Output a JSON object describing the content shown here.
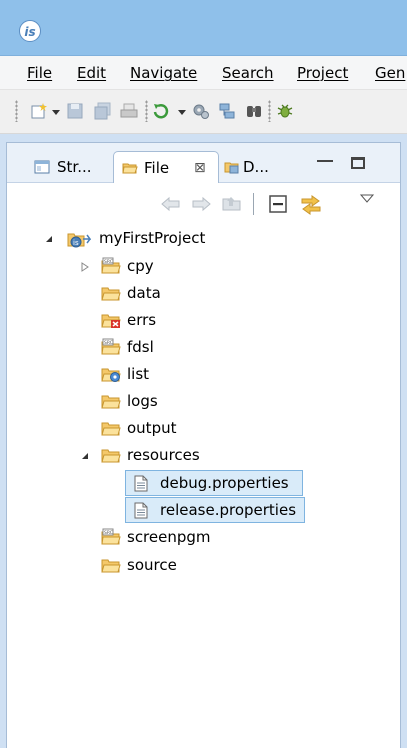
{
  "titlebar": {
    "logo_text": "is"
  },
  "menu": {
    "items": [
      "File",
      "Edit",
      "Navigate",
      "Search",
      "Project",
      "Gen"
    ]
  },
  "toolbar": {
    "icons": [
      "new-wizard-icon",
      "save-icon",
      "save-all-icon",
      "print-icon",
      "refresh-icon",
      "build-icon",
      "deploy-icon",
      "search-binoculars-icon",
      "debug-icon"
    ]
  },
  "panel": {
    "tabs": [
      {
        "label": "Str...",
        "icon": "structure-icon",
        "active": false
      },
      {
        "label": "File",
        "icon": "folder-icon",
        "active": true,
        "close": "⊠"
      },
      {
        "label": "D...",
        "icon": "data-icon",
        "active": false
      }
    ],
    "minimize": "▭",
    "maximize": "☐"
  },
  "tree": {
    "project": "myFirstProject",
    "items": [
      {
        "label": "cpy",
        "icon": "source-folder-icon",
        "expandable": true,
        "expanded": false
      },
      {
        "label": "data",
        "icon": "folder-icon"
      },
      {
        "label": "errs",
        "icon": "error-folder-icon"
      },
      {
        "label": "fdsl",
        "icon": "source-folder-icon"
      },
      {
        "label": "list",
        "icon": "list-folder-icon"
      },
      {
        "label": "logs",
        "icon": "folder-icon"
      },
      {
        "label": "output",
        "icon": "folder-icon"
      },
      {
        "label": "resources",
        "icon": "folder-icon",
        "expandable": true,
        "expanded": true
      },
      {
        "label": "debug.properties",
        "icon": "file-icon",
        "child": true,
        "selected": true
      },
      {
        "label": "release.properties",
        "icon": "file-icon",
        "child": true,
        "selected": true
      },
      {
        "label": "screenpgm",
        "icon": "source-folder-icon"
      },
      {
        "label": "source",
        "icon": "folder-icon"
      }
    ]
  },
  "colors": {
    "titlebar": "#8fc0ea",
    "selection_bg": "#d9ebf9",
    "selection_border": "#7fb4e0",
    "folder": "#f4c86a"
  }
}
